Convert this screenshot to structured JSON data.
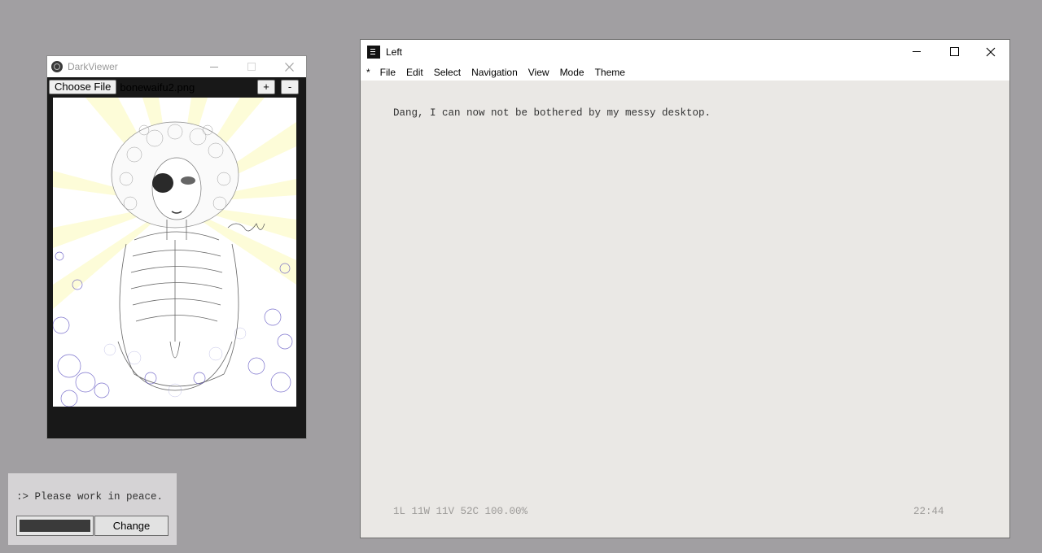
{
  "darkviewer": {
    "title": "DarkViewer",
    "choose_file_label": "Choose File",
    "filename": "bonewaifu2.png",
    "zoom_in_label": "+",
    "zoom_out_label": "-",
    "icons": {
      "app": "darkviewer-app-icon",
      "minimize": "minimize-icon",
      "maximize": "maximize-icon",
      "close": "close-icon"
    }
  },
  "mini_widget": {
    "message": ":> Please work in peace.",
    "button_label": "Change"
  },
  "editor": {
    "title": "Left",
    "icons": {
      "app": "left-app-icon",
      "minimize": "minimize-icon",
      "maximize": "maximize-icon",
      "close": "close-icon"
    },
    "menu": {
      "modified_marker": "*",
      "items": [
        "File",
        "Edit",
        "Select",
        "Navigation",
        "View",
        "Mode",
        "Theme"
      ]
    },
    "content": "Dang, I can now not be bothered by my messy desktop.",
    "stats": "1L 11W 11V 52C 100.00%",
    "clock": "22:44"
  },
  "colors": {
    "desktop": "#a19fa2",
    "viewer_bg": "#181818",
    "editor_bg": "#eae8e5",
    "status_text": "#9c9a98"
  }
}
